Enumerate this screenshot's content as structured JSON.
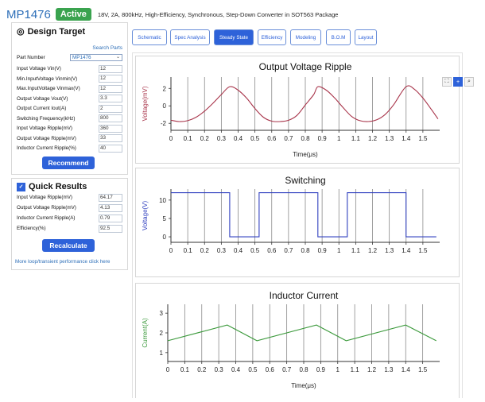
{
  "header": {
    "title": "MP1476",
    "badge": "Active",
    "description": "18V, 2A, 800kHz, High-Efficiency, Synchronous, Step-Down Converter in SOT563 Package"
  },
  "design_target": {
    "title": "Design Target",
    "search_parts": "Search Parts",
    "part_number_label": "Part Number",
    "part_number_value": "MP1476",
    "fields": [
      {
        "label": "Input Voltage Vin(V)",
        "value": "12"
      },
      {
        "label": "Min.InputVoltage Vinmin(V)",
        "value": "12"
      },
      {
        "label": "Max.InputVoltage Vinmax(V)",
        "value": "12"
      },
      {
        "label": "Output Voltage Vout(V)",
        "value": "3.3"
      },
      {
        "label": "Output Current Iout(A)",
        "value": "2"
      },
      {
        "label": "Switching Frequency(kHz)",
        "value": "800"
      },
      {
        "label": "Input Voltage Ripple(mV)",
        "value": "360"
      },
      {
        "label": "Output Voltage Ripple(mV)",
        "value": "33"
      },
      {
        "label": "Inductor Current Ripple(%)",
        "value": "40"
      }
    ],
    "recommend_label": "Recommend"
  },
  "quick_results": {
    "title": "Quick Results",
    "fields": [
      {
        "label": "Input Voltage Ripple(mV)",
        "value": "64.17"
      },
      {
        "label": "Output Voltage Ripple(mV)",
        "value": "4.13"
      },
      {
        "label": "Inductor Current Ripple(A)",
        "value": "0.79"
      },
      {
        "label": "Efficiency(%)",
        "value": "92.5"
      }
    ],
    "recalculate_label": "Recalculate",
    "more_link": "More loop/transient performance click here"
  },
  "tabs": [
    {
      "label": "Schematic",
      "active": false
    },
    {
      "label": "Spec Analysis",
      "active": false
    },
    {
      "label": "Steady State",
      "active": true
    },
    {
      "label": "Efficiency",
      "active": false
    },
    {
      "label": "Modeling",
      "active": false
    },
    {
      "label": "B.O.M",
      "active": false
    },
    {
      "label": "Layout",
      "active": false
    }
  ],
  "toolbar": [
    {
      "icon": "zoom-fit-icon",
      "glyph": "⛶"
    },
    {
      "icon": "zoom-in-icon",
      "glyph": "+"
    },
    {
      "icon": "magnifier-icon",
      "glyph": "⌕"
    }
  ],
  "colors": {
    "brand": "#2e6fb8",
    "button": "#2e62d9",
    "badge": "#3aa34f",
    "ripple_line": "#a8344a",
    "switching_line": "#2f3fbf",
    "inductor_line": "#3c9a3c"
  },
  "chart_data": [
    {
      "type": "line",
      "title": "Output Voltage Ripple",
      "xlabel": "Time(μs)",
      "ylabel": "Voltage(mV)",
      "xlim": [
        0,
        1.6
      ],
      "ylim": [
        -2.8,
        3.3
      ],
      "xticks": [
        "0",
        "0.1",
        "0.2",
        "0.3",
        "0.4",
        "0.5",
        "0.6",
        "0.7",
        "0.8",
        "0.9",
        "1",
        "1.1",
        "1.2",
        "1.3",
        "1.4",
        "1.5"
      ],
      "yticks": [
        "2",
        "0",
        "-2"
      ],
      "ytick_values": [
        2,
        0,
        -2
      ],
      "grid": "vertical",
      "x": [
        0,
        0.05,
        0.1,
        0.15,
        0.2,
        0.25,
        0.3,
        0.35,
        0.4,
        0.45,
        0.5,
        0.55,
        0.6,
        0.65,
        0.7,
        0.75,
        0.8,
        0.85,
        0.875,
        0.925,
        0.975,
        1.025,
        1.075,
        1.125,
        1.175,
        1.225,
        1.275,
        1.325,
        1.4,
        1.45,
        1.5,
        1.55,
        1.59
      ],
      "y": [
        -1.65,
        -1.8,
        -1.7,
        -1.3,
        -0.6,
        0.3,
        1.3,
        2.2,
        1.8,
        0.9,
        -0.3,
        -1.3,
        -1.75,
        -1.8,
        -1.65,
        -1.1,
        0.1,
        1.3,
        2.2,
        1.8,
        0.9,
        -0.2,
        -1.2,
        -1.7,
        -1.8,
        -1.6,
        -1.0,
        0.1,
        2.2,
        1.9,
        0.9,
        -0.4,
        -1.5
      ]
    },
    {
      "type": "line",
      "title": "Switching",
      "xlabel": "",
      "ylabel": "Voltage(V)",
      "xlim": [
        0,
        1.6
      ],
      "ylim": [
        -1.5,
        13
      ],
      "xticks": [
        "0",
        "0.1",
        "0.2",
        "0.3",
        "0.4",
        "0.5",
        "0.6",
        "0.7",
        "0.8",
        "0.9",
        "1",
        "1.1",
        "1.2",
        "1.3",
        "1.4",
        "1.5"
      ],
      "yticks": [
        "10",
        "5",
        "0"
      ],
      "ytick_values": [
        10,
        5,
        0
      ],
      "grid": "vertical",
      "x": [
        0,
        0.35,
        0.35,
        0.525,
        0.525,
        0.875,
        0.875,
        1.05,
        1.05,
        1.4,
        1.4,
        1.58
      ],
      "y": [
        12,
        12,
        0,
        0,
        12,
        12,
        0,
        0,
        12,
        12,
        0,
        0
      ]
    },
    {
      "type": "line",
      "title": "Inductor Current",
      "xlabel": "Time(μs)",
      "ylabel": "Current(A)",
      "xlim": [
        0,
        1.6
      ],
      "ylim": [
        0.55,
        3.45
      ],
      "xticks": [
        "0",
        "0.1",
        "0.2",
        "0.3",
        "0.4",
        "0.5",
        "0.6",
        "0.7",
        "0.8",
        "0.9",
        "1",
        "1.1",
        "1.2",
        "1.3",
        "1.4",
        "1.5"
      ],
      "yticks": [
        "3",
        "2",
        "1"
      ],
      "ytick_values": [
        3,
        2,
        1
      ],
      "grid": "vertical",
      "x": [
        0,
        0.35,
        0.525,
        0.875,
        1.05,
        1.4,
        1.58
      ],
      "y": [
        1.6,
        2.4,
        1.6,
        2.4,
        1.6,
        2.4,
        1.6
      ]
    }
  ]
}
